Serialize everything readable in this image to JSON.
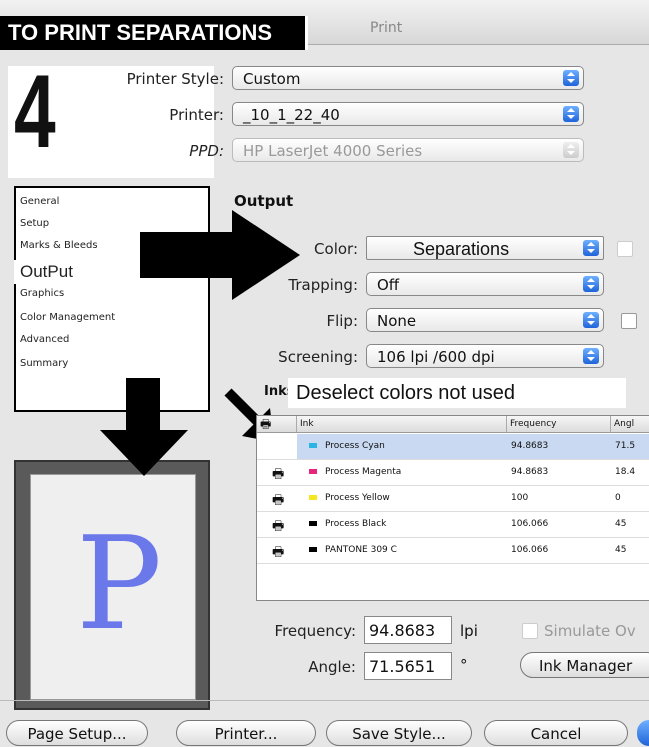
{
  "window": {
    "title": "Print"
  },
  "banner": {
    "text": "TO PRINT SEPARATIONS",
    "step": "4"
  },
  "printer_settings": {
    "style_label": "Printer Style:",
    "style_value": "Custom",
    "printer_label": "Printer:",
    "printer_value": "_10_1_22_40",
    "ppd_label": "PPD:",
    "ppd_value": "HP LaserJet 4000 Series"
  },
  "sidebar": {
    "items": [
      {
        "label": "General"
      },
      {
        "label": "Setup"
      },
      {
        "label": "Marks & Bleeds"
      },
      {
        "label": "OutPut"
      },
      {
        "label": "Graphics"
      },
      {
        "label": "Color Management"
      },
      {
        "label": "Advanced"
      },
      {
        "label": "Summary"
      }
    ]
  },
  "output": {
    "section_title": "Output",
    "color_label": "Color:",
    "color_value": "Separations",
    "trapping_label": "Trapping:",
    "trapping_value": "Off",
    "flip_label": "Flip:",
    "flip_value": "None",
    "screening_label": "Screening:",
    "screening_value": "106 lpi /600 dpi"
  },
  "inks": {
    "title": "Inks",
    "note": "Deselect colors not used",
    "columns": [
      "Ink",
      "Frequency",
      "Angl"
    ],
    "rows": [
      {
        "name": "Process Cyan",
        "frequency": "94.8683",
        "angle": "71.5",
        "color": "#29b6e6"
      },
      {
        "name": "Process Magenta",
        "frequency": "94.8683",
        "angle": "18.4",
        "color": "#e6257d"
      },
      {
        "name": "Process Yellow",
        "frequency": "100",
        "angle": "0",
        "color": "#f5e61e"
      },
      {
        "name": "Process Black",
        "frequency": "106.066",
        "angle": "45",
        "color": "#000000"
      },
      {
        "name": "PANTONE 309 C",
        "frequency": "106.066",
        "angle": "45",
        "color": "#000000"
      }
    ]
  },
  "bottom_fields": {
    "frequency_label": "Frequency:",
    "frequency_value": "94.8683",
    "frequency_unit": "lpi",
    "angle_label": "Angle:",
    "angle_value": "71.5651",
    "angle_unit": "°",
    "simulate_label": "Simulate Ov",
    "ink_manager_label": "Ink Manager"
  },
  "buttons": {
    "page_setup": "Page Setup...",
    "printer": "Printer...",
    "save_style": "Save Style...",
    "cancel": "Cancel"
  },
  "preview": {
    "glyph": "P"
  }
}
